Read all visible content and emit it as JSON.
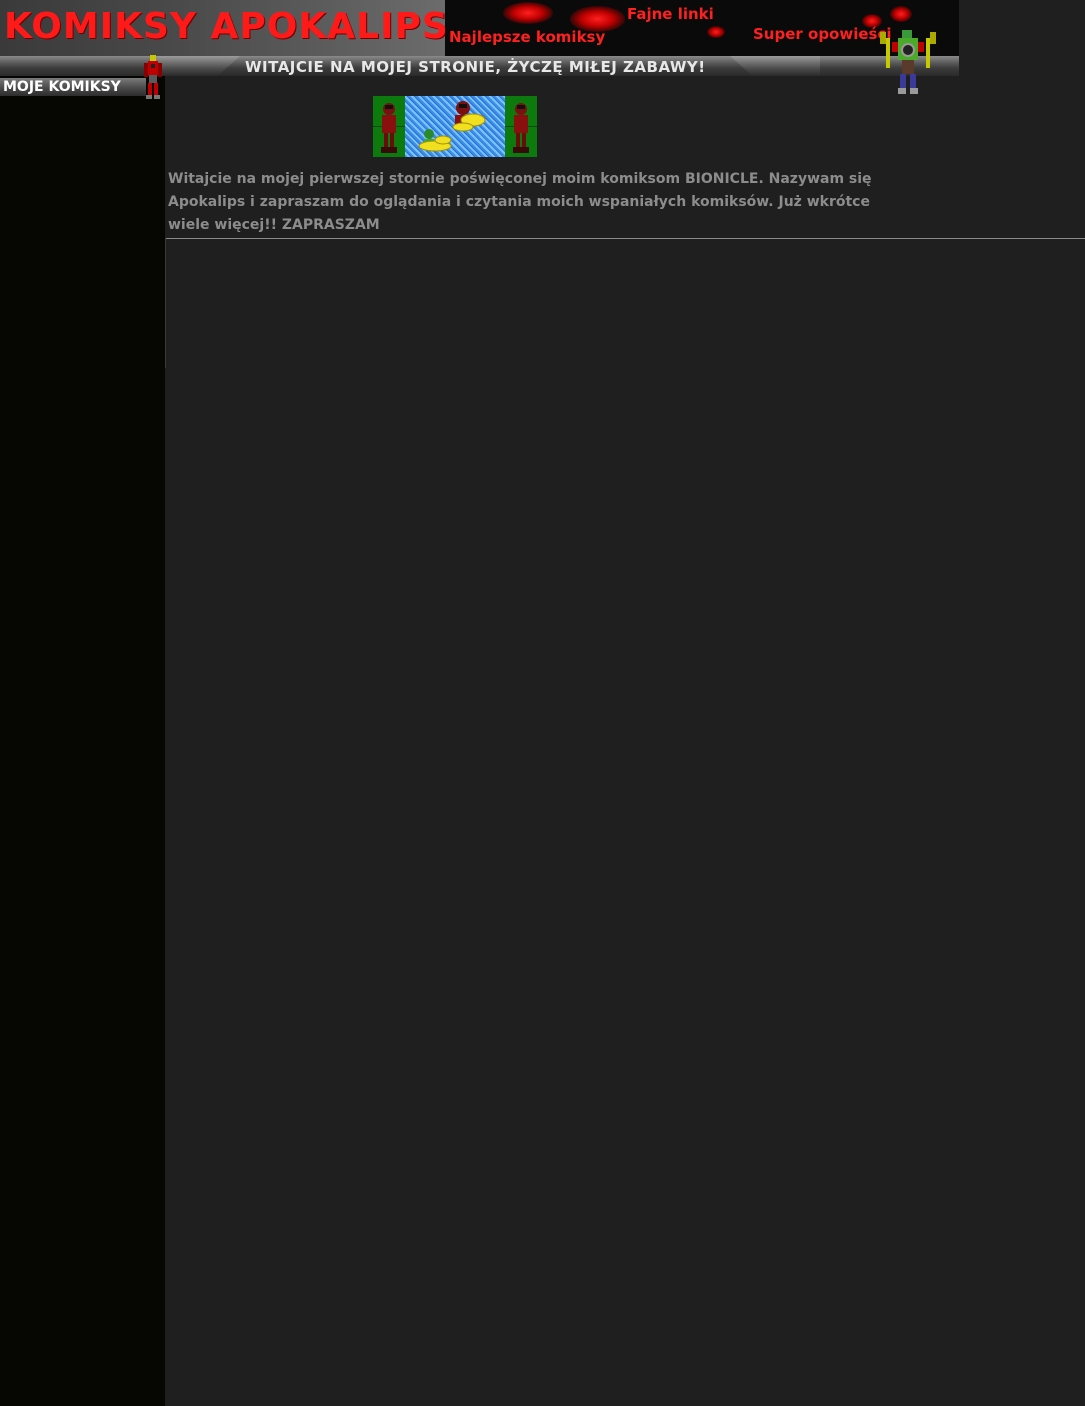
{
  "header": {
    "site_title": "KOMIKSY APOKALIPSA",
    "nav_links": [
      {
        "label": "Fajne linki"
      },
      {
        "label": "Najlepsze komiksy"
      },
      {
        "label": "Super opowieści"
      }
    ]
  },
  "welcome_bar": {
    "text": "WITAJCIE NA MOJEJ STRONIE, ŻYCZĘ MIŁEJ ZABAWY!"
  },
  "sidebar": {
    "heading": "MOJE KOMIKSY"
  },
  "main": {
    "intro_text": "Witajcie na mojej pierwszej stornie poświęconej moim komiksom BIONICLE. Nazywam się Apokalips  i zapraszam do oglądania i czytania moich wspaniałych komiksów. Już wkrótce wiele więcej!! ZAPRASZAM"
  },
  "colors": {
    "accent_red": "#ff2020",
    "page_background": "#1f1f1f",
    "sidebar_background": "#060702",
    "body_text": "#8c8c8c"
  },
  "icons": [
    "red-robot-figure-icon",
    "green-robot-figure-icon",
    "comic-strip-image"
  ]
}
